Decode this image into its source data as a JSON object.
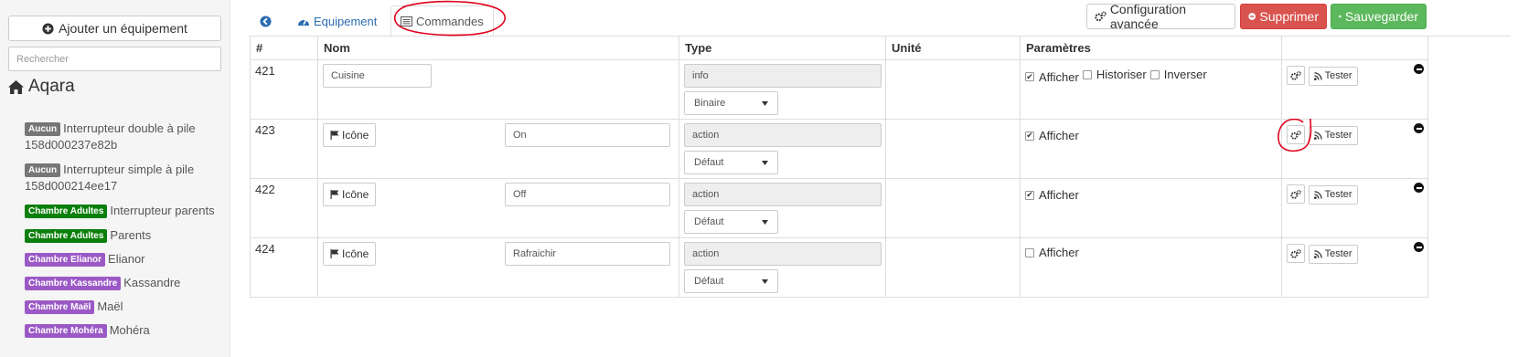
{
  "sidebar": {
    "add_label": "Ajouter un équipement",
    "search_placeholder": "Rechercher",
    "object_name": "Aqara",
    "equipments": [
      {
        "object": "Aucun",
        "color": "#767676",
        "name": "Interrupteur double à pile 158d000237e82b"
      },
      {
        "object": "Aucun",
        "color": "#767676",
        "name": "Interrupteur simple à pile 158d000214ee17"
      },
      {
        "object": "Chambre Adultes",
        "color": "#0b7f0b",
        "name": "Interrupteur parents"
      },
      {
        "object": "Chambre Adultes",
        "color": "#0b7f0b",
        "name": "Parents"
      },
      {
        "object": "Chambre Elianor",
        "color": "#9b59c6",
        "name": "Elianor"
      },
      {
        "object": "Chambre Kassandre",
        "color": "#9b59c6",
        "name": "Kassandre"
      },
      {
        "object": "Chambre Maël",
        "color": "#9b59c6",
        "name": "Maël"
      },
      {
        "object": "Chambre Mohéra",
        "color": "#9b59c6",
        "name": "Mohéra"
      }
    ]
  },
  "tabs": {
    "back_icon": "arrow-circle-left-icon",
    "equipment": "Equipement",
    "commands": "Commandes"
  },
  "toolbar": {
    "config": "Configuration avancée",
    "delete": "Supprimer",
    "save": "Sauvegarder"
  },
  "table": {
    "headers": {
      "id": "#",
      "name": "Nom",
      "type": "Type",
      "unit": "Unité",
      "params": "Paramètres"
    },
    "icon_label": "Icône",
    "test_label": "Tester",
    "show_label": "Afficher",
    "history_label": "Historiser",
    "invert_label": "Inverser",
    "rows": [
      {
        "id": "421",
        "name": "Cuisine",
        "type": "info",
        "subtype": "Binaire",
        "show": true,
        "history": false,
        "invert": false
      },
      {
        "id": "423",
        "name": "On",
        "type": "action",
        "subtype": "Défaut",
        "show": true
      },
      {
        "id": "422",
        "name": "Off",
        "type": "action",
        "subtype": "Défaut",
        "show": true
      },
      {
        "id": "424",
        "name": "Rafraichir",
        "type": "action",
        "subtype": "Défaut",
        "show": false
      }
    ]
  },
  "colors": {
    "accent": "#2b6cb0",
    "danger": "#d9534f",
    "success": "#5cb85c",
    "annotation": "#e0001b"
  }
}
